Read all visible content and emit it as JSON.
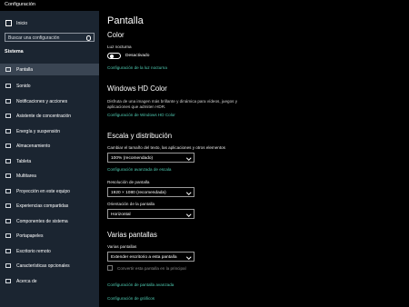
{
  "window": {
    "title": "Configuración"
  },
  "sidebar": {
    "home_label": "Inicio",
    "search_placeholder": "Buscar una configuración",
    "section_label": "Sistema",
    "items": [
      {
        "label": "Pantalla",
        "icon": "monitor-icon",
        "active": true
      },
      {
        "label": "Sonido",
        "icon": "speaker-icon"
      },
      {
        "label": "Notificaciones y acciones",
        "icon": "notification-icon"
      },
      {
        "label": "Asistente de concentración",
        "icon": "moon-icon"
      },
      {
        "label": "Energía y suspensión",
        "icon": "power-icon"
      },
      {
        "label": "Almacenamiento",
        "icon": "storage-icon"
      },
      {
        "label": "Tableta",
        "icon": "tablet-icon"
      },
      {
        "label": "Multitarea",
        "icon": "multitask-icon"
      },
      {
        "label": "Proyección en este equipo",
        "icon": "projection-icon"
      },
      {
        "label": "Experiencias compartidas",
        "icon": "share-icon"
      },
      {
        "label": "Componentes de sistema",
        "icon": "components-icon"
      },
      {
        "label": "Portapapeles",
        "icon": "clipboard-icon"
      },
      {
        "label": "Escritorio remoto",
        "icon": "remote-desktop-icon"
      },
      {
        "label": "Características opcionales",
        "icon": "optional-features-icon"
      },
      {
        "label": "Acerca de",
        "icon": "info-icon"
      }
    ]
  },
  "main": {
    "title": "Pantalla",
    "color_heading": "Color",
    "night_light_label": "Luz nocturna",
    "night_light_state": "Desactivado",
    "night_light_link": "Configuración de la luz nocturna",
    "hdr_heading": "Windows HD Color",
    "hdr_desc": "Disfruta de una imagen más brillante y dinámica para vídeos, juegos y aplicaciones que admiten HDR.",
    "hdr_link": "Configuración de Windows HD Color",
    "scale_heading": "Escala y distribución",
    "scale_label": "Cambiar el tamaño del texto, las aplicaciones y otros elementos",
    "scale_value": "100% (recomendado)",
    "scale_link": "Configuración avanzada de escala",
    "resolution_label": "Resolución de pantalla",
    "resolution_value": "1920 × 1080 (recomendada)",
    "orientation_label": "Orientación de la pantalla",
    "orientation_value": "Horizontal",
    "multi_heading": "Varias pantallas",
    "multi_label": "Varias pantallas",
    "multi_value": "Extender escritorio a esta pantalla",
    "main_display_checkbox": "Convertir esta pantalla en la principal",
    "advanced_display_link": "Configuración de pantalla avanzada",
    "graphics_link": "Configuración de gráficos"
  },
  "colors": {
    "accent": "#4ec9b0",
    "sidebar_bg": "#1b2531",
    "active_item": "#3a4553"
  }
}
